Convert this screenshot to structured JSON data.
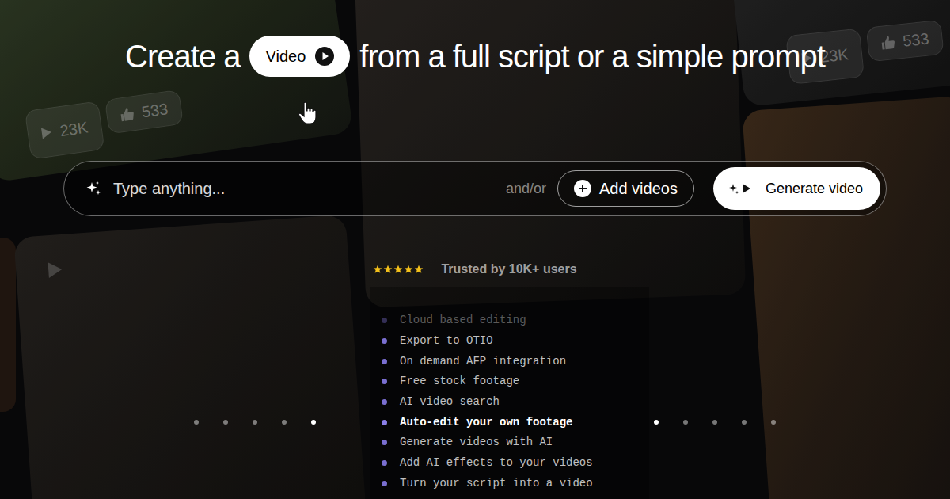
{
  "headline": {
    "before": "Create a",
    "pill": "Video",
    "after": "from a full script or a simple prompt"
  },
  "prompt": {
    "placeholder": "Type anything...",
    "separator": "and/or",
    "add_button": "Add videos",
    "generate_button": "Generate video"
  },
  "trust": {
    "stars": 5,
    "label": "Trusted by 10K+ users"
  },
  "features": [
    {
      "label": "Cloud based editing",
      "selected": false
    },
    {
      "label": "Export to OTIO",
      "selected": false
    },
    {
      "label": "On demand AFP integration",
      "selected": false
    },
    {
      "label": "Free stock footage",
      "selected": false
    },
    {
      "label": "AI video search",
      "selected": false
    },
    {
      "label": "Auto-edit your own footage",
      "selected": true
    },
    {
      "label": "Generate videos with AI",
      "selected": false
    },
    {
      "label": "Add AI effects to your videos",
      "selected": false
    },
    {
      "label": "Turn your script into a video",
      "selected": false
    }
  ],
  "carousel_left": [
    {
      "selected": false
    },
    {
      "selected": false
    },
    {
      "selected": false
    },
    {
      "selected": false
    },
    {
      "selected": true
    }
  ],
  "carousel_right": [
    {
      "selected": true
    },
    {
      "selected": false
    },
    {
      "selected": false
    },
    {
      "selected": false
    },
    {
      "selected": false
    }
  ],
  "video_cards": [
    {
      "views": "23K",
      "likes": "533"
    },
    {
      "views": "23K",
      "likes": "533"
    }
  ]
}
